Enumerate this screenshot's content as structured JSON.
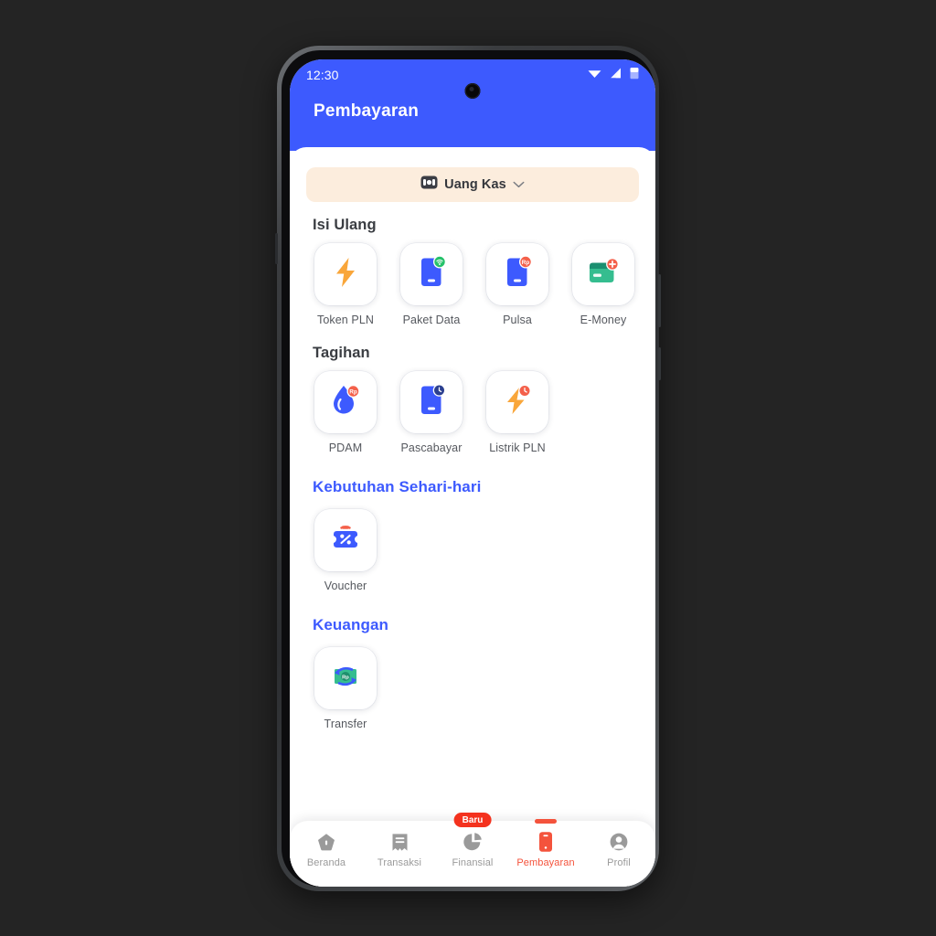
{
  "device": {
    "status_bar": {
      "time": "12:30",
      "icons": [
        "wifi-icon",
        "cellular-signal-icon",
        "battery-icon"
      ]
    }
  },
  "header": {
    "title": "Pembayaran",
    "background_color": "#3d5afe"
  },
  "wallet_selector": {
    "icon": "cash-wallet-icon",
    "label": "Uang Kas",
    "chevron": "chevron-down-icon",
    "background_color": "#fceddd"
  },
  "sections": [
    {
      "title": "Isi Ulang",
      "accent": false,
      "items": [
        {
          "label": "Token PLN",
          "icon": "lightning-bolt-icon"
        },
        {
          "label": "Paket Data",
          "icon": "phone-wifi-icon"
        },
        {
          "label": "Pulsa",
          "icon": "phone-rupiah-icon"
        },
        {
          "label": "E-Money",
          "icon": "card-plus-icon"
        }
      ]
    },
    {
      "title": "Tagihan",
      "accent": false,
      "items": [
        {
          "label": "PDAM",
          "icon": "water-drop-rupiah-icon"
        },
        {
          "label": "Pascabayar",
          "icon": "phone-clock-icon"
        },
        {
          "label": "Listrik PLN",
          "icon": "lightning-clock-icon"
        }
      ]
    },
    {
      "title": "Kebutuhan Sehari-hari",
      "accent": true,
      "items": [
        {
          "label": "Voucher",
          "icon": "voucher-percent-icon"
        }
      ]
    },
    {
      "title": "Keuangan",
      "accent": true,
      "items": [
        {
          "label": "Transfer",
          "icon": "money-transfer-icon"
        }
      ]
    }
  ],
  "bottom_nav": {
    "active_color": "#f4533c",
    "inactive_color": "#9a9a9a",
    "items": [
      {
        "label": "Beranda",
        "icon": "home-icon",
        "active": false,
        "badge": null
      },
      {
        "label": "Transaksi",
        "icon": "receipt-icon",
        "active": false,
        "badge": null
      },
      {
        "label": "Finansial",
        "icon": "pie-chart-icon",
        "active": false,
        "badge": "Baru"
      },
      {
        "label": "Pembayaran",
        "icon": "smartphone-icon",
        "active": true,
        "badge": null
      },
      {
        "label": "Profil",
        "icon": "user-avatar-icon",
        "active": false,
        "badge": null
      }
    ]
  }
}
